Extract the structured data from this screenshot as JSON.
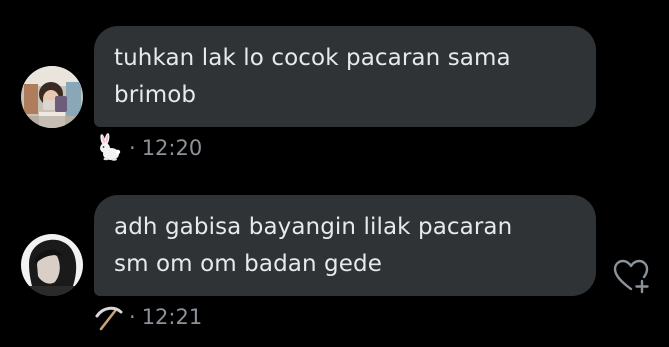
{
  "messages": [
    {
      "text": "tuhkan lak lo cocok pacaran sama\nbrimob",
      "reaction": "rabbit",
      "time": "12:20"
    },
    {
      "text": "adh gabisa bayangin lilak pacaran\nsm om om badan gede",
      "reaction": "pick",
      "time": "12:21"
    }
  ],
  "separator": "·",
  "colors": {
    "background": "#000000",
    "bubble": "#2f3336",
    "text": "#e7e9ea",
    "meta": "#8b9299"
  }
}
